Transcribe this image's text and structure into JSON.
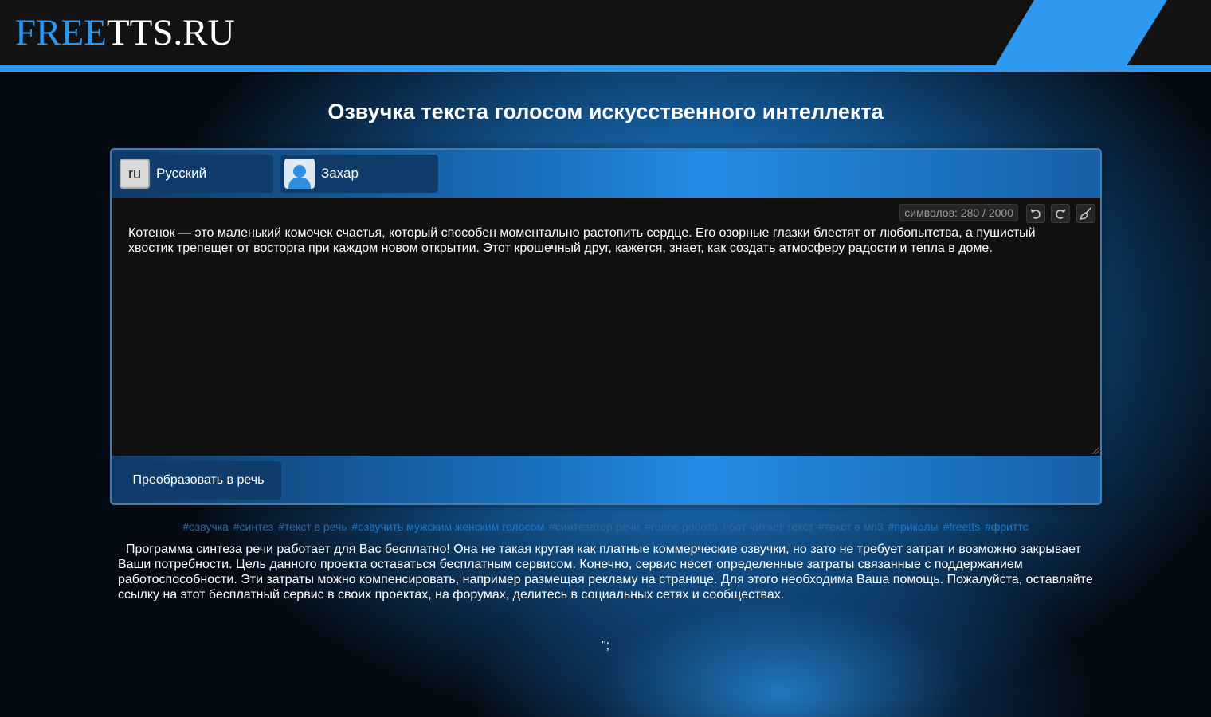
{
  "header": {
    "logo_part1": "FREE",
    "logo_part2": "TTS.RU"
  },
  "page_title": "Озвучка текста голосом искусственного интеллекта",
  "language_selector": {
    "code": "ru",
    "label": "Русский"
  },
  "voice_selector": {
    "label": "Захар",
    "icon": "user-avatar-icon"
  },
  "editor": {
    "counter": "символов: 280 / 2000",
    "text": "Котенок — это маленький комочек счастья, который способен моментально растопить сердце. Его озорные глазки блестят от любопытства, а пушистый хвостик трепещет от восторга при каждом новом открытии. Этот крошечный друг, кажется, знает, как создать атмосферу радости и тепла в доме.",
    "tools": [
      "undo-icon",
      "redo-icon",
      "clear-broom-icon"
    ]
  },
  "convert_button": "Преобразовать в речь",
  "tags": [
    "#озвучка",
    "#синтез",
    "#текст в речь",
    "#озвучить мужским женским голосом",
    "#синтезатор речи",
    "#голос робота",
    "#бот читает текст",
    "#текст в мп3",
    "#приколы",
    "#freetts",
    "#фриттс"
  ],
  "description": "Программа синтеза речи работает для Вас бесплатно! Она не такая крутая как платные коммерческие озвучки, но зато не требует затрат и возможно закрывает Ваши потребности. Цель данного проекта оставаться бесплатным сервисом. Конечно, сервис несет определенные затраты связанные с поддержанием работоспособности. Эти затраты можно компенсировать, например размещая рекламу на странице. Для этого необходима Ваша помощь. Пожалуйста, оставляйте ссылку на этот бесплатный сервис в своих проектах, на форумах, делитесь в социальных сетях и сообществах.",
  "stray_text": "\";",
  "colors": {
    "accent_blue": "#2f99f0",
    "header_bg": "#121212",
    "panel_dark": "#0f3c6a"
  }
}
